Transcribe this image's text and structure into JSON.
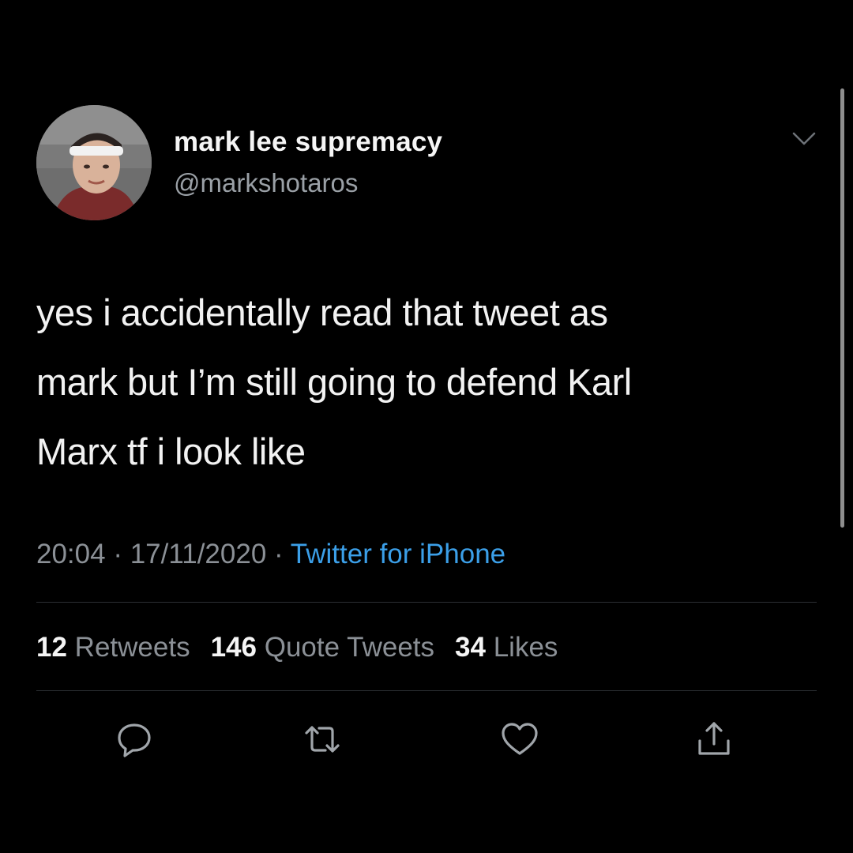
{
  "user": {
    "display_name": "mark lee supremacy",
    "handle": "@markshotaros",
    "avatar_icon": "profile-photo"
  },
  "tweet": {
    "lines": [
      "yes i accidentally read that tweet as",
      "mark but I’m still going to defend Karl",
      "Marx tf i look like"
    ],
    "time": "20:04",
    "date": "17/11/2020",
    "separator": "·",
    "source": "Twitter for iPhone"
  },
  "stats": {
    "retweets_count": "12",
    "retweets_label": "Retweets",
    "quote_tweets_count": "146",
    "quote_tweets_label": "Quote Tweets",
    "likes_count": "34",
    "likes_label": "Likes"
  },
  "actions": [
    "reply-icon",
    "retweet-icon",
    "like-icon",
    "share-icon"
  ],
  "colors": {
    "background": "#000000",
    "text": "#f2f2f2",
    "secondary": "#8b9096",
    "link": "#3b9fe8",
    "icon": "#9aa0a6"
  }
}
